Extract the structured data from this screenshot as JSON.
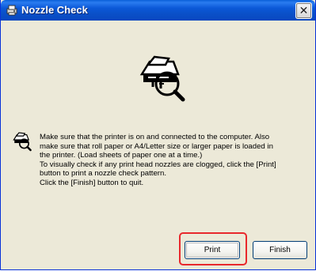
{
  "window": {
    "title": "Nozzle Check",
    "title_icon": "printer-nozzle-icon",
    "close_icon": "close-icon",
    "close_glyph": "✕"
  },
  "content": {
    "main_icon": "printer-magnifier-icon",
    "message_icon": "printer-magnifier-small-icon",
    "message_lines": [
      "Make sure that the printer is on and connected to the computer. Also",
      "make sure that roll paper or A4/Letter size or larger paper is loaded in",
      "the printer. (Load sheets of paper one at a time.)",
      "To visually check if any print head nozzles are clogged, click the [Print]",
      "button to print a nozzle check pattern.",
      "Click the [Finish] button to quit."
    ]
  },
  "buttons": {
    "print_label": "Print",
    "finish_label": "Finish"
  },
  "colors": {
    "titlebar": "#0a4fc7",
    "dialog_bg": "#ece9d8",
    "highlight": "#e8282c"
  }
}
